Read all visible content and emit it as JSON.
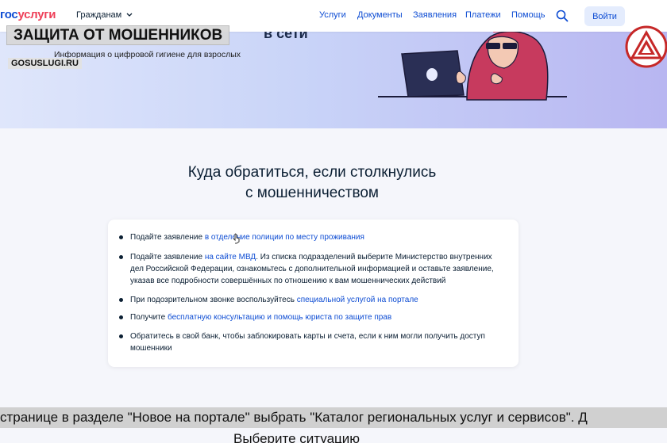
{
  "header": {
    "logo_gos": "гос",
    "logo_uslugi": "услуги",
    "audience": "Гражданам",
    "nav": [
      "Услуги",
      "Документы",
      "Заявления",
      "Платежи",
      "Помощь"
    ],
    "login": "Войти"
  },
  "hero": {
    "title_overlay": "ЗАЩИТА ОТ МОШЕННИКОВ",
    "title_tail": "в сети",
    "subtitle": "Информация о цифровой гигиене для взрослых",
    "site_label": "GOSUSLUGI.RU"
  },
  "main": {
    "heading_line1": "Куда обратиться, если столкнулись",
    "heading_line2": "с мошенничеством",
    "items": [
      {
        "text": "Подайте заявление ",
        "link": "в отделение полиции по месту проживания",
        "tail": ""
      },
      {
        "text": "Подайте заявление ",
        "link": "на сайте МВД",
        "tail": ". Из списка подразделений выберите Министерство внутренних дел Российской Федерации, ознакомьтесь с дополнительной информацией и оставьте заявление, указав все подробности совершённых по отношению к вам мошеннических действий"
      },
      {
        "text": "При подозрительном звонке воспользуйтесь ",
        "link": "специальной услугой на портале",
        "tail": ""
      },
      {
        "text": "Получите ",
        "link": "бесплатную консультацию и помощь юриста по защите прав",
        "tail": ""
      },
      {
        "text": "Обратитесь в свой банк, чтобы заблокировать карты и счета, если к ним могли получить доступ мошенники",
        "link": "",
        "tail": ""
      }
    ]
  },
  "captions": {
    "line1": "странице в разделе \"Новое на портале\" выбрать \"Каталог региональных услуг и сервисов\". Д",
    "line2": "Выберите ситуацию"
  },
  "colors": {
    "brand_blue": "#0d4cd3",
    "brand_red": "#ee3f58",
    "hood": "#c73a5e"
  }
}
